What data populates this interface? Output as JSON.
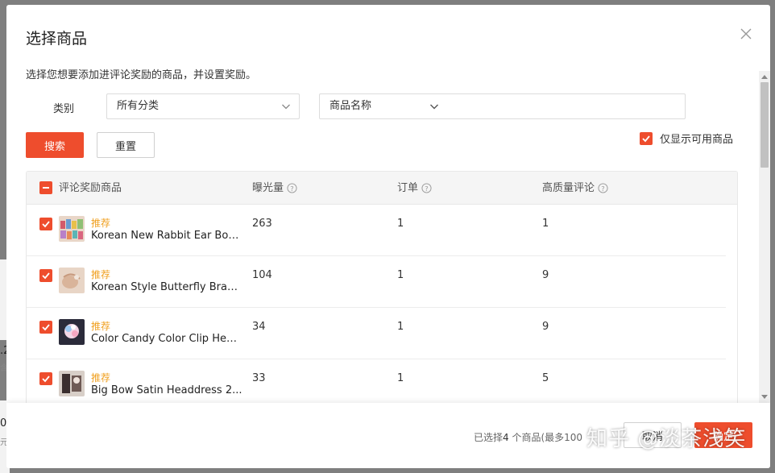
{
  "dialog": {
    "title": "选择商品",
    "description": "选择您想要添加进评论奖励的商品，并设置奖励。"
  },
  "filters": {
    "category_label": "类别",
    "category_value": "所有分类",
    "search_field_value": "商品名称",
    "search_input_value": "",
    "search_button": "搜索",
    "reset_button": "重置",
    "only_available_label": "仅显示可用商品",
    "only_available_checked": true
  },
  "table": {
    "headers": [
      "评论奖励商品",
      "曝光量",
      "订单",
      "高质量评论"
    ],
    "rows": [
      {
        "tag": "推荐",
        "name": "Korean New Rabbit Ear Bow...",
        "exposure": "263",
        "orders": "1",
        "quality_reviews": "1",
        "checked": true
      },
      {
        "tag": "推荐",
        "name": "Korean Style Butterfly Brac...",
        "exposure": "104",
        "orders": "1",
        "quality_reviews": "9",
        "checked": true
      },
      {
        "tag": "推荐",
        "name": "Color Candy Color Clip Hea...",
        "exposure": "34",
        "orders": "1",
        "quality_reviews": "9",
        "checked": true
      },
      {
        "tag": "推荐",
        "name": "Big Bow Satin Headdress 2...",
        "exposure": "33",
        "orders": "1",
        "quality_reviews": "5",
        "checked": true
      }
    ]
  },
  "footer": {
    "selected_prefix": "已选择",
    "selected_count": "4",
    "selected_suffix": " 个商品(最多100",
    "cancel_button": "取消",
    "confirm_button": "确定"
  },
  "background": {
    "edge_chars": [
      ".2",
      "含",
      "0",
      "元"
    ]
  },
  "watermark": "知乎 @淡茶浅笑",
  "colors": {
    "accent": "#ee4d2d",
    "tag": "#f0a020"
  }
}
